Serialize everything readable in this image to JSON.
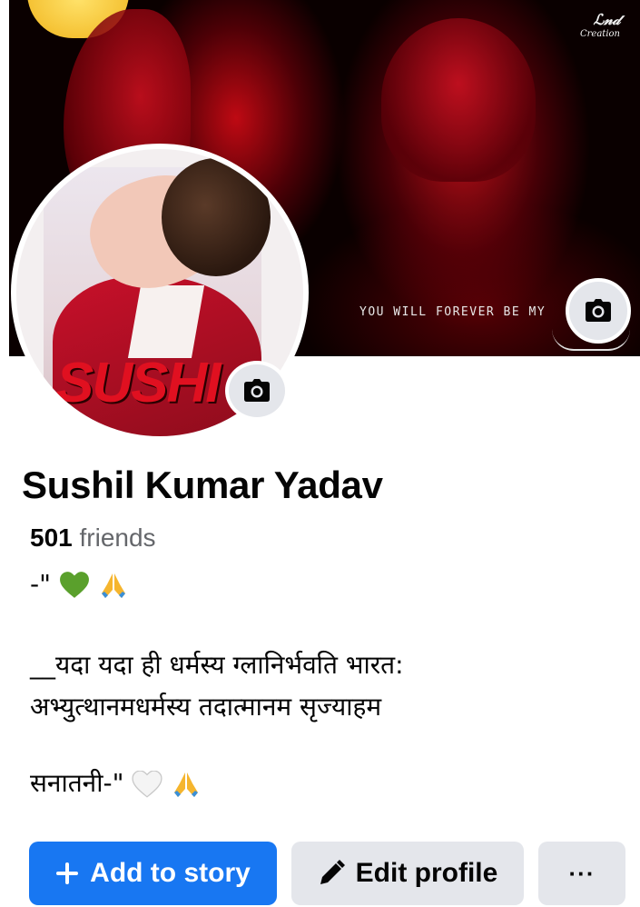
{
  "cover": {
    "watermark": "Creation",
    "caption": "YOU WILL FOREVER BE MY",
    "camera_icon": "camera-icon"
  },
  "avatar": {
    "overlay_text": "SUSHI",
    "camera_icon": "camera-icon"
  },
  "profile": {
    "name": "Sushil Kumar Yadav",
    "friends_count": "501",
    "friends_label": " friends"
  },
  "bio": {
    "line1_text": "-\"",
    "line2": "__यदा यदा ही धर्मस्य ग्लानिर्भवति भारत:",
    "line3": "अभ्युत्थानमधर्मस्य तदात्मानम सृज्याहम",
    "line4_text": "सनातनी-\""
  },
  "actions": {
    "add_story_label": "Add to story",
    "edit_profile_label": "Edit profile",
    "more_label": "···"
  },
  "colors": {
    "primary": "#1877f2",
    "secondary_bg": "#e4e6eb",
    "muted_text": "#65676b"
  }
}
